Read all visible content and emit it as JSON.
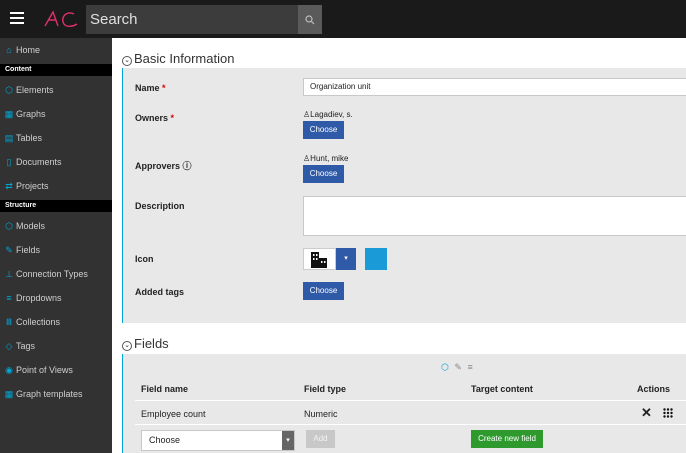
{
  "topbar": {
    "search_label": "Search",
    "icons": [
      "hamburger-icon",
      "logo-icon",
      "search-icon"
    ]
  },
  "sidebar": {
    "items": [
      {
        "label": "Home",
        "icon": "home-icon"
      },
      {
        "section": "Content"
      },
      {
        "label": "Elements",
        "icon": "cube-icon"
      },
      {
        "label": "Graphs",
        "icon": "graph-icon"
      },
      {
        "label": "Tables",
        "icon": "table-icon"
      },
      {
        "label": "Documents",
        "icon": "document-icon"
      },
      {
        "label": "Projects",
        "icon": "arrows-icon"
      },
      {
        "section": "Structure"
      },
      {
        "label": "Models",
        "icon": "cube-icon"
      },
      {
        "label": "Fields",
        "icon": "edit-icon"
      },
      {
        "label": "Connection Types",
        "icon": "hierarchy-icon"
      },
      {
        "label": "Dropdowns",
        "icon": "list-icon"
      },
      {
        "label": "Collections",
        "icon": "library-icon"
      },
      {
        "label": "Tags",
        "icon": "tag-icon"
      },
      {
        "label": "Point of Views",
        "icon": "eye-icon"
      },
      {
        "label": "Graph templates",
        "icon": "grid-icon"
      }
    ]
  },
  "basic_info": {
    "title": "Basic Information",
    "name_label": "Name",
    "name_value": "Organization unit",
    "owners_label": "Owners",
    "owners_user": "Lagadiev, s.",
    "approvers_label": "Approvers",
    "approvers_info": "ⓘ",
    "approvers_user": "Hunt, mike",
    "description_label": "Description",
    "description_value": "",
    "icon_label": "Icon",
    "added_tags_label": "Added tags",
    "choose_label": "Choose",
    "required_mark": "*",
    "color_swatch": "#1a9bd7"
  },
  "fields": {
    "title": "Fields",
    "headers": [
      "Field name",
      "Field type",
      "Target content",
      "Actions"
    ],
    "rows": [
      {
        "name": "Employee count",
        "type": "Numeric",
        "target": ""
      }
    ],
    "select_value": "Choose",
    "add_label": "Add",
    "create_label": "Create new field",
    "toolbar_icons": [
      "cube-icon",
      "edit-icon",
      "list-icon"
    ]
  },
  "colors": {
    "accent": "#00a6d6",
    "button_blue": "#2f5aa8",
    "button_green": "#2e9a2e",
    "sidebar_bg": "#323232",
    "topbar_bg": "#1a1a1a"
  }
}
